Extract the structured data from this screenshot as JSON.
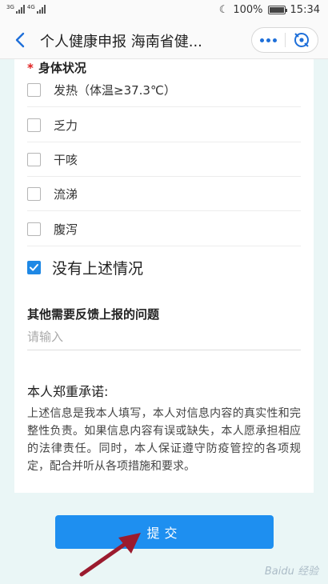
{
  "status_bar": {
    "signal_1": "3G",
    "signal_2": "4G",
    "battery_text": "100%",
    "battery_level": 1.0,
    "time": "15:34"
  },
  "nav": {
    "title": "个人健康申报 海南省健..."
  },
  "form": {
    "symptoms_title": "身体状况",
    "required_mark": "*",
    "options": [
      {
        "label": "发热（体温≥37.3℃）",
        "checked": false
      },
      {
        "label": "乏力",
        "checked": false
      },
      {
        "label": "干咳",
        "checked": false
      },
      {
        "label": "流涕",
        "checked": false
      },
      {
        "label": "腹泻",
        "checked": false
      }
    ],
    "none_option": {
      "label": "没有上述情况",
      "checked": true
    },
    "other_issue_label": "其他需要反馈上报的问题",
    "other_issue_placeholder": "请输入",
    "other_issue_value": ""
  },
  "pledge": {
    "title": "本人郑重承诺:",
    "text": "上述信息是我本人填写，本人对信息内容的真实性和完整性负责。如果信息内容有误或缺失，本人愿承担相应的法律责任。同时，本人保证遵守防疫管控的各项规定，配合并听从各项措施和要求。"
  },
  "submit_label": "提交",
  "watermark": "Baidu 经验",
  "colors": {
    "accent": "#1e88e5",
    "button": "#1e8ff0",
    "required": "#e02020",
    "arrow": "#9b1b2e"
  }
}
